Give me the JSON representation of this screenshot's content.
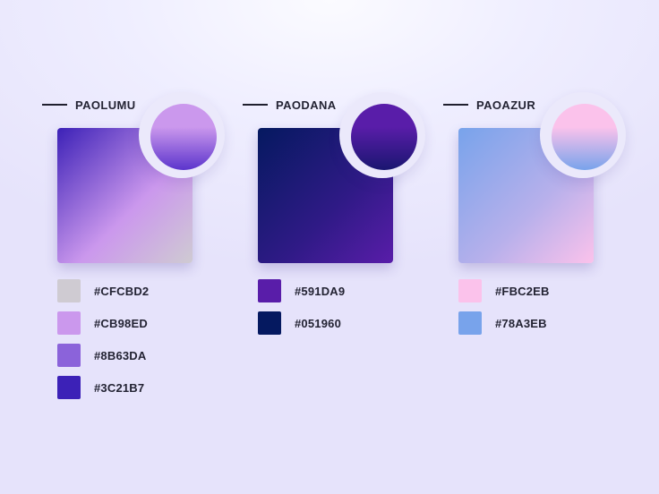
{
  "palettes": [
    {
      "title": "PAOLUMU",
      "gradient_from": "#3C21B7",
      "gradient_mid": "#CB98ED",
      "gradient_to": "#CFCBD2",
      "circle_top": "#CB98ED",
      "circle_bottom": "#5B34CC",
      "swatches": [
        {
          "hex": "#CFCBD2",
          "color": "#CFCBD2"
        },
        {
          "hex": "#CB98ED",
          "color": "#CB98ED"
        },
        {
          "hex": "#8B63DA",
          "color": "#8B63DA"
        },
        {
          "hex": "#3C21B7",
          "color": "#3C21B7"
        }
      ]
    },
    {
      "title": "PAODANA",
      "gradient_from": "#051960",
      "gradient_mid": "#2F1A86",
      "gradient_to": "#591DA9",
      "circle_top": "#591DA9",
      "circle_bottom": "#1A1670",
      "swatches": [
        {
          "hex": "#591DA9",
          "color": "#591DA9"
        },
        {
          "hex": "#051960",
          "color": "#051960"
        }
      ]
    },
    {
      "title": "PAOAZUR",
      "gradient_from": "#78A3EB",
      "gradient_mid": "#B7B0EB",
      "gradient_to": "#FBC2EB",
      "circle_top": "#FBC2EB",
      "circle_bottom": "#78A3EB",
      "swatches": [
        {
          "hex": "#FBC2EB",
          "color": "#FBC2EB"
        },
        {
          "hex": "#78A3EB",
          "color": "#78A3EB"
        }
      ]
    }
  ]
}
